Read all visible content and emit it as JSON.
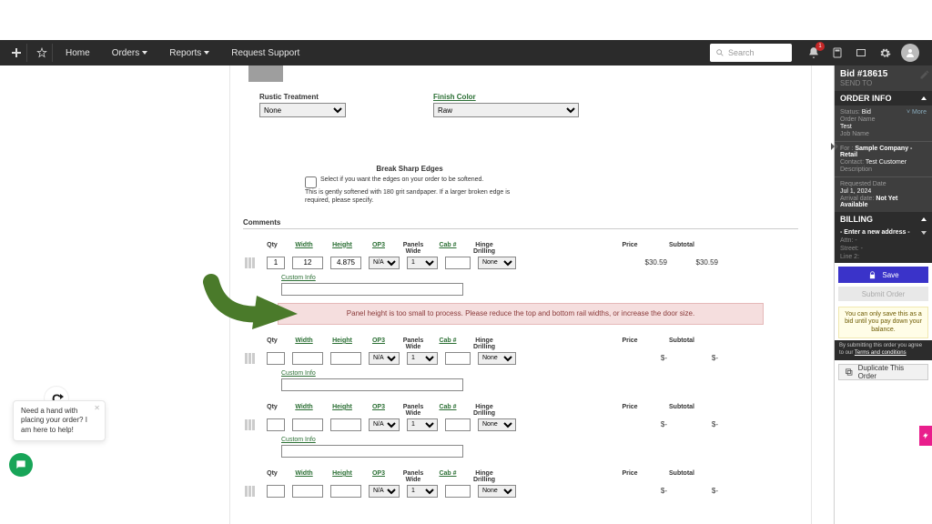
{
  "nav": {
    "home": "Home",
    "orders": "Orders",
    "reports": "Reports",
    "support": "Request Support",
    "search_placeholder": "Search",
    "notif_count": "1"
  },
  "form": {
    "rustic_label": "Rustic Treatment",
    "rustic_value": "None",
    "finish_label": "Finish Color",
    "finish_value": "Raw",
    "break_edges_header": "Break Sharp Edges",
    "break_edges_row1": "Select if you want the edges on your order to be softened.",
    "break_edges_row2": "This is gently softened with 180 grit sandpaper. If a larger broken edge is required, please specify.",
    "comments_label": "Comments",
    "custom_info_label": "Custom Info",
    "headers": {
      "qty": "Qty",
      "width": "Width",
      "height": "Height",
      "op3": "OP3",
      "panels": "Panels Wide",
      "cab": "Cab #",
      "hinge": "Hinge Drilling",
      "price": "Price",
      "subtotal": "Subtotal"
    },
    "op3_value": "N/A",
    "panels_value": "1",
    "hinge_value": "None",
    "line1": {
      "qty": "1",
      "width": "12",
      "height": "4.875",
      "price": "$30.59",
      "subtotal": "$30.59"
    },
    "line2": {
      "price": "$-",
      "subtotal": "$-"
    },
    "line3": {
      "price": "$-",
      "subtotal": "$-"
    },
    "line4": {
      "price": "$-",
      "subtotal": "$-"
    },
    "error_msg": "Panel height is too small to process. Please reduce the top and bottom rail widths, or increase the door size."
  },
  "sidebar": {
    "bid_label": "Bid #18615",
    "send_to": "SEND TO",
    "order_info": "ORDER INFO",
    "status_k": "Status:",
    "status_v": "Bid",
    "more": "˅ More",
    "ordername_k": "Order Name",
    "ordername_v": "Test",
    "jobname_k": "Job Name",
    "for_k": "For :",
    "for_v": "Sample Company - Retail",
    "contact_k": "Contact:",
    "contact_v": "Test Customer",
    "desc_k": "Description",
    "req_k": "Requested Date",
    "req_v": "Jul 1, 2024",
    "arr_k": "Arrival date:",
    "arr_v": "Not Yet Available",
    "billing": "BILLING",
    "addr_title": "- Enter a new address -",
    "addr_attn": "Attn: -",
    "addr_street": "Street: -",
    "addr_line2": "Line 2:",
    "save": "Save",
    "submit": "Submit Order",
    "warn": "You can only save this as a bid until you pay down your balance.",
    "terms_pre": "By submitting this order you agree to our ",
    "terms_link": "Terms and conditions",
    "duplicate": "Duplicate This Order"
  },
  "chat": {
    "text": "Need a hand with placing your order? I am here to help!"
  }
}
